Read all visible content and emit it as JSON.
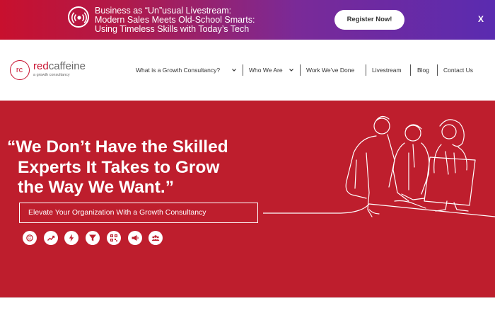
{
  "promo": {
    "lines": [
      "Business as “Un”usual Livestream:",
      "Modern Sales Meets Old-School Smarts:",
      "Using Timeless Skills with Today’s Tech"
    ],
    "register_label": "Register Now!",
    "close_label": "X",
    "icon": "broadcast-icon"
  },
  "logo": {
    "mark": "rc",
    "word_red": "red",
    "word_grey": "caffeine",
    "tagline": "a growth consultancy"
  },
  "nav": {
    "items": [
      {
        "label": "What is a Growth Consultancy?",
        "has_dropdown": true
      },
      {
        "label": "Who We Are",
        "has_dropdown": true
      },
      {
        "label": "Work We’ve Done",
        "has_dropdown": false
      },
      {
        "label": "Livestream",
        "has_dropdown": false
      },
      {
        "label": "Blog",
        "has_dropdown": false
      },
      {
        "label": "Contact Us",
        "has_dropdown": false
      }
    ]
  },
  "hero": {
    "headline_lines": [
      "“We Don’t Have the Skilled",
      "Experts It Takes to Grow",
      "the Way We Want.”"
    ],
    "cta_label": "Elevate Your Organization With a Growth Consultancy",
    "service_icons": [
      "brain-icon",
      "growth-chart-icon",
      "lightning-icon",
      "funnel-icon",
      "qr-code-icon",
      "megaphone-icon",
      "team-icon"
    ]
  },
  "colors": {
    "brand_red": "#be1e2d",
    "banner_gradient_start": "#c8102e",
    "banner_gradient_end": "#5a2bb0"
  }
}
